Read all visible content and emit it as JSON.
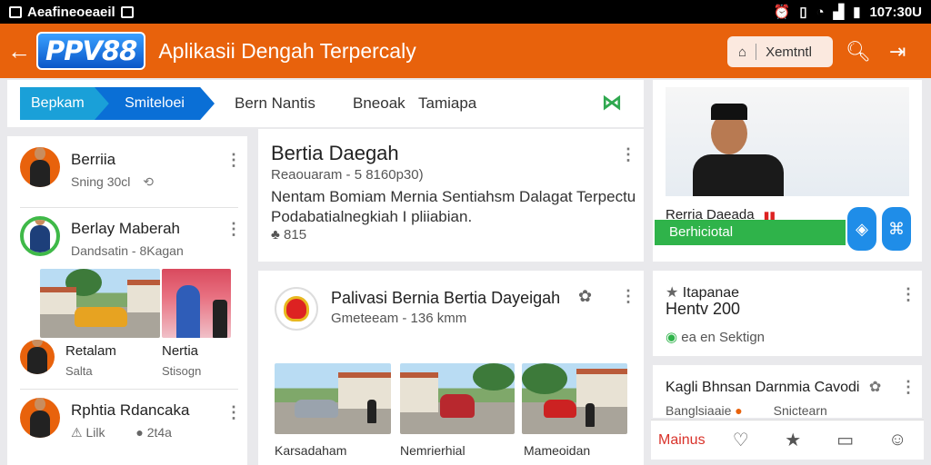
{
  "status_bar": {
    "left_text": "Aeafineoeaeil",
    "time": "107:30U"
  },
  "app_bar": {
    "logo": "PPV88",
    "title": "Aplikasii Dengah Terpercaly",
    "button_label": "Xemtntl"
  },
  "tabs": {
    "items": [
      "Bepkam",
      "Smiteloei",
      "Bern Nantis",
      "Bneoak",
      "Tamiapa"
    ]
  },
  "sidebar": {
    "items": [
      {
        "title": "Berriia",
        "sub": "Sning 30cl"
      },
      {
        "title": "Berlay Maberah",
        "sub": "Dandsatin - 8Kagan"
      },
      {
        "title": "Retalam",
        "sub": "Salta"
      },
      {
        "title": "Nertia",
        "sub": "Stisogn"
      },
      {
        "title": "Rphtia Rdancaka",
        "sub_left": "Lilk",
        "sub_right": "2t4a"
      }
    ]
  },
  "post1": {
    "title": "Bertia Daegah",
    "meta": "Reaouaram - 5 8160p30)",
    "body_line1": "Nentam Bomiam Mernia Sentiahsm Dalagat Terpectu",
    "body_line2": "Podabatialnegkiah I pliiabian.",
    "stat": "815"
  },
  "post2": {
    "title": "Palivasi Bernia Bertia Dayeigah",
    "meta": "Gmeteeam - 136 kmm",
    "captions": [
      "Karsadaham",
      "Nemrierhial",
      "Mameoidan"
    ]
  },
  "profile": {
    "name": "Rerria Daeada",
    "bar_label": "Berhiciotal"
  },
  "stats_card": {
    "title": "Itapanae",
    "value": "Hentv 200",
    "link": "ea en Sektign"
  },
  "news_card": {
    "title": "Kagli Bhnsan Darnmia Cavodi",
    "sub_left": "Banglsiaaie",
    "sub_right": "Snictearn"
  },
  "bottom_nav": {
    "label": "Mainus"
  },
  "colors": {
    "accent": "#e8620c",
    "blue": "#0a6fd6",
    "green": "#2fb34a"
  }
}
